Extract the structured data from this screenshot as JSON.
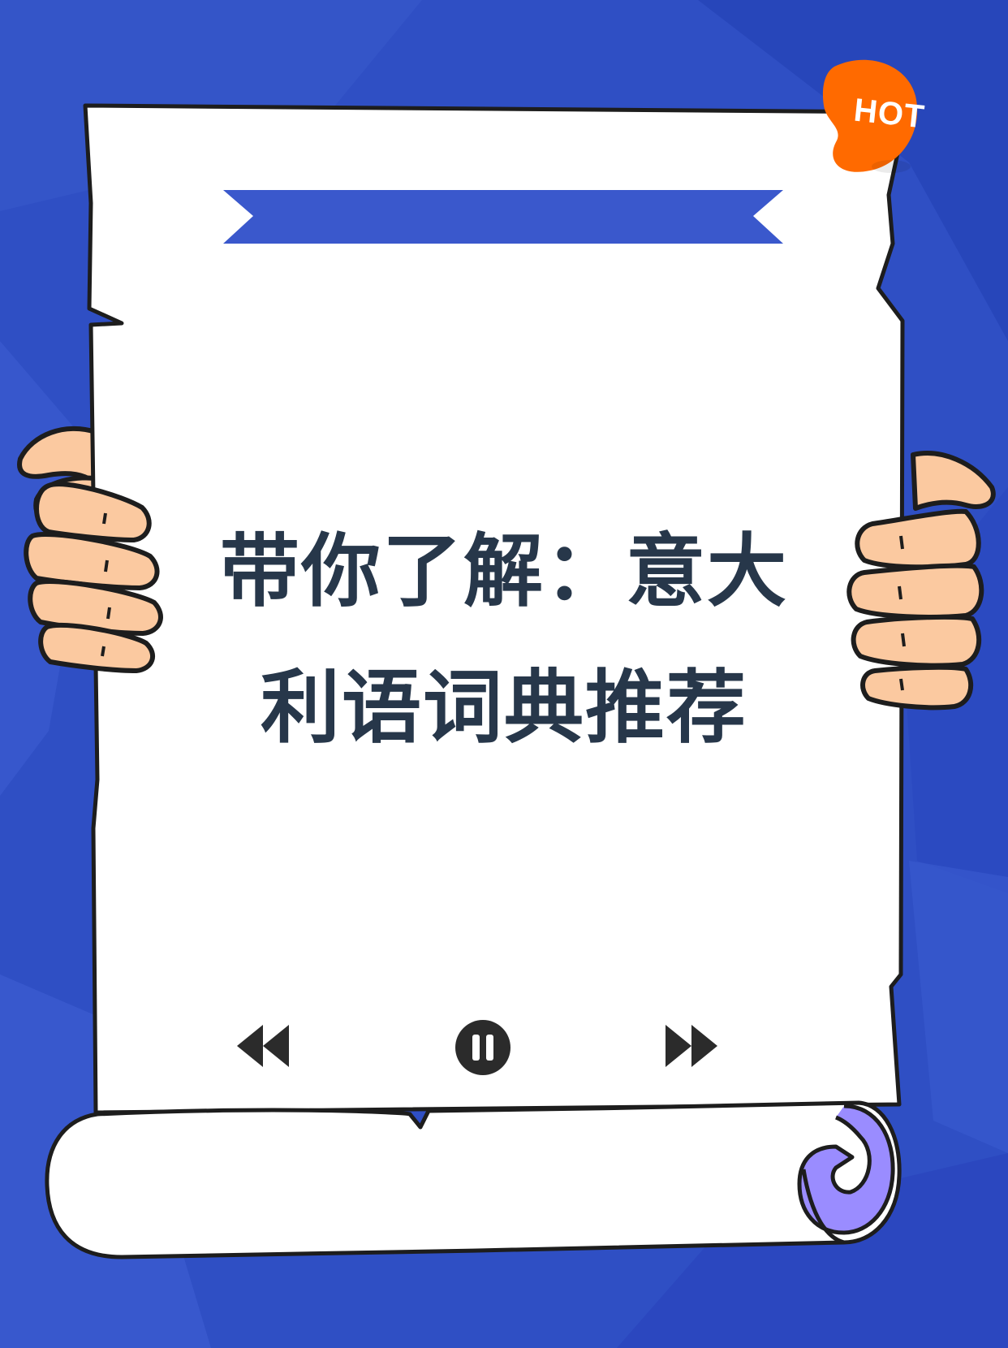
{
  "badge": {
    "label": "HOT",
    "color": "#ff6a00"
  },
  "title": {
    "line1": "带你了解：意大",
    "line2": "利语词典推荐",
    "color": "#27374a"
  },
  "banner": {
    "color": "#3a58cc"
  },
  "controls": [
    {
      "name": "rewind-icon"
    },
    {
      "name": "pause-icon"
    },
    {
      "name": "fast-forward-icon"
    }
  ],
  "colors": {
    "background": "#2f4fc4",
    "paper": "#ffffff",
    "skin": "#fbc9a0",
    "scroll_end": "#9a8cff",
    "ink": "#1d1d1d"
  }
}
